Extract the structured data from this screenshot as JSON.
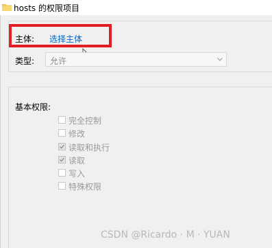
{
  "window": {
    "title": "hosts 的权限项目"
  },
  "principal": {
    "label": "主体:",
    "link": "选择主体"
  },
  "type": {
    "label": "类型:",
    "selected": "允许"
  },
  "basic_permissions": {
    "label": "基本权限:",
    "items": [
      {
        "label": "完全控制",
        "checked": false
      },
      {
        "label": "修改",
        "checked": false
      },
      {
        "label": "读取和执行",
        "checked": true
      },
      {
        "label": "读取",
        "checked": true
      },
      {
        "label": "写入",
        "checked": false
      },
      {
        "label": "特殊权限",
        "checked": false
      }
    ]
  },
  "watermark": "CSDN @Ricardo · M · YUAN",
  "colors": {
    "highlight": "#e31e24",
    "link": "#0066cc",
    "folder": "#f2c14e"
  }
}
